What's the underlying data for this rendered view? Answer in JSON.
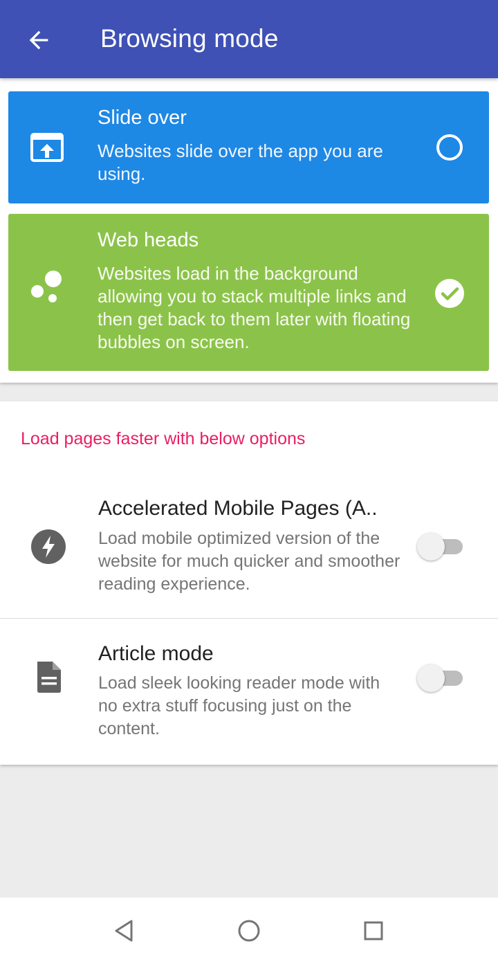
{
  "appbar": {
    "title": "Browsing mode",
    "back_icon": "arrow-back-icon"
  },
  "modes": [
    {
      "title": "Slide over",
      "description": "Websites slide over the app you are using.",
      "icon": "slide-over-icon",
      "selected": false,
      "color": "#1e88e5"
    },
    {
      "title": "Web heads",
      "description": "Websites load in the background allowing you to stack multiple links and then get back to them later with floating bubbles on screen.",
      "icon": "bubbles-icon",
      "selected": true,
      "color": "#8bc34a"
    }
  ],
  "options": {
    "header": "Load pages faster with below options",
    "header_color": "#e91e63",
    "items": [
      {
        "title": "Accelerated Mobile Pages (A..",
        "description": "Load mobile optimized version of the website for much quicker and smoother reading experience.",
        "icon": "lightning-icon",
        "enabled": false
      },
      {
        "title": "Article mode",
        "description": "Load sleek looking reader mode with no extra stuff focusing just on the content.",
        "icon": "document-icon",
        "enabled": false
      }
    ]
  },
  "navbar": {
    "buttons": [
      "back-triangle-icon",
      "home-circle-icon",
      "recents-square-icon"
    ]
  },
  "colors": {
    "appbar": "#3f51b5",
    "background": "#ececec"
  }
}
